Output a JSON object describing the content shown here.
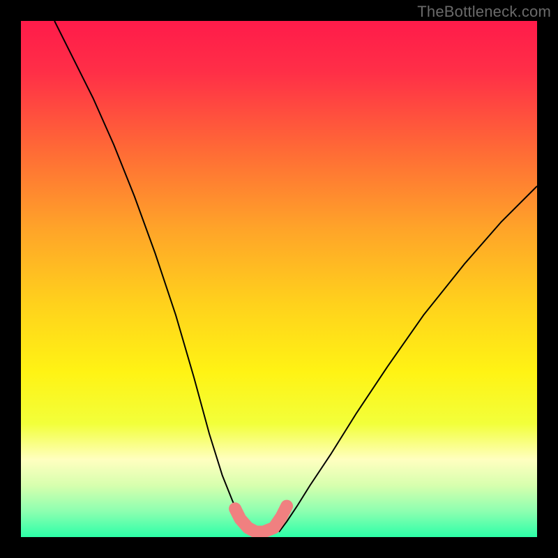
{
  "watermark": "TheBottleneck.com",
  "chart_data": {
    "type": "line",
    "title": "",
    "xlabel": "",
    "ylabel": "",
    "xlim": [
      0,
      1
    ],
    "ylim": [
      0,
      1
    ],
    "grid": false,
    "legend": false,
    "background": {
      "type": "vertical-gradient",
      "stops": [
        {
          "offset": 0.0,
          "color": "#ff1b4a"
        },
        {
          "offset": 0.1,
          "color": "#ff2f47"
        },
        {
          "offset": 0.25,
          "color": "#ff6a36"
        },
        {
          "offset": 0.4,
          "color": "#ffa329"
        },
        {
          "offset": 0.55,
          "color": "#ffd21c"
        },
        {
          "offset": 0.68,
          "color": "#fff314"
        },
        {
          "offset": 0.78,
          "color": "#f2ff3a"
        },
        {
          "offset": 0.85,
          "color": "#ffffc0"
        },
        {
          "offset": 0.9,
          "color": "#d7ffae"
        },
        {
          "offset": 0.95,
          "color": "#8dffb0"
        },
        {
          "offset": 1.0,
          "color": "#2cffa8"
        }
      ]
    },
    "series": [
      {
        "name": "left-curve",
        "color": "#000000",
        "width": 2,
        "x": [
          0.065,
          0.1,
          0.14,
          0.18,
          0.22,
          0.26,
          0.3,
          0.335,
          0.365,
          0.39,
          0.41,
          0.425,
          0.44
        ],
        "y": [
          1.0,
          0.93,
          0.85,
          0.76,
          0.66,
          0.55,
          0.43,
          0.31,
          0.2,
          0.12,
          0.07,
          0.035,
          0.01
        ]
      },
      {
        "name": "right-curve",
        "color": "#000000",
        "width": 2,
        "x": [
          0.5,
          0.515,
          0.535,
          0.56,
          0.6,
          0.65,
          0.71,
          0.78,
          0.86,
          0.93,
          1.0
        ],
        "y": [
          0.01,
          0.03,
          0.06,
          0.1,
          0.16,
          0.24,
          0.33,
          0.43,
          0.53,
          0.61,
          0.68
        ]
      },
      {
        "name": "optimum-marker",
        "color": "#f08080",
        "width": 18,
        "linecap": "round",
        "x": [
          0.415,
          0.425,
          0.44,
          0.455,
          0.47,
          0.49,
          0.505,
          0.515
        ],
        "y": [
          0.055,
          0.035,
          0.018,
          0.01,
          0.01,
          0.018,
          0.04,
          0.06
        ]
      }
    ]
  }
}
